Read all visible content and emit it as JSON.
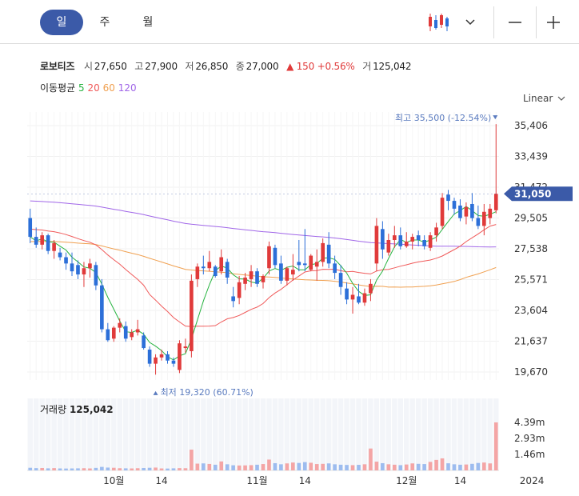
{
  "tabs": [
    "일",
    "주",
    "월"
  ],
  "active_tab": 0,
  "icons": {
    "chart_type": "candlestick-icon",
    "dropdown": "chevron-down-icon",
    "zoom_out": "minus-icon",
    "zoom_in": "plus-icon"
  },
  "stock": {
    "name": "로보티즈",
    "open_label": "시",
    "open": "27,650",
    "high_label": "고",
    "high": "27,900",
    "low_label": "저",
    "low": "26,850",
    "close_label": "종",
    "close": "27,000",
    "change": "▲ 150 +0.56%",
    "volume_label": "거",
    "volume": "125,042"
  },
  "moving_average": {
    "label": "이동평균",
    "periods": [
      "5",
      "20",
      "60",
      "120"
    ],
    "colors": {
      "5": "#27b340",
      "20": "#f05a5a",
      "60": "#f0a050",
      "120": "#a066e8"
    }
  },
  "scale_label": "Linear",
  "colors": {
    "up": "#e03a3a",
    "down": "#2c6fd8",
    "current": "#3b5aa8",
    "volume_up": "#f4a5a5",
    "volume_down": "#9dbcef"
  },
  "chart_data": {
    "type": "candlestick",
    "price_axis": {
      "ticks": [
        35406,
        33439,
        31472,
        29505,
        27538,
        25571,
        23604,
        21637,
        19670
      ],
      "labels": [
        "35,406",
        "33,439",
        "31,472",
        "29,505",
        "27,538",
        "25,571",
        "23,604",
        "21,637",
        "19,670"
      ]
    },
    "current_price": {
      "value": 31050,
      "label": "31,050"
    },
    "annotations": {
      "high": {
        "label": "최고",
        "value_text": "35,500 (-12.54%)",
        "value": 35500
      },
      "low": {
        "label": "최저",
        "value_text": "19,320 (60.71%)",
        "value": 19320
      }
    },
    "time_labels": [
      "10월",
      "14",
      "11월",
      "14",
      "12월",
      "14",
      "2024"
    ],
    "time_label_index": [
      14,
      22,
      38,
      46,
      63,
      72,
      84
    ],
    "volume_title": "거래량",
    "volume_value": "125,042",
    "volume_axis": [
      "4.39m",
      "2.93m",
      "1.46m"
    ],
    "volume_axis_values": [
      4390000,
      2930000,
      1460000
    ],
    "candles": [
      [
        29500,
        30100,
        27900,
        28300
      ],
      [
        28300,
        28900,
        27600,
        27800
      ],
      [
        27800,
        28600,
        27500,
        28400
      ],
      [
        28400,
        28500,
        27200,
        27400
      ],
      [
        27400,
        28100,
        26900,
        27900
      ],
      [
        27300,
        27600,
        26800,
        27000
      ],
      [
        27000,
        27300,
        26200,
        26600
      ],
      [
        26600,
        27300,
        25800,
        26100
      ],
      [
        26500,
        26800,
        25600,
        25900
      ],
      [
        25900,
        26700,
        25100,
        26300
      ],
      [
        26300,
        26900,
        25700,
        26600
      ],
      [
        26500,
        26700,
        24900,
        25200
      ],
      [
        25200,
        25600,
        22200,
        22400
      ],
      [
        22400,
        22800,
        21600,
        21700
      ],
      [
        21800,
        22600,
        21600,
        22500
      ],
      [
        22500,
        23100,
        22200,
        22800
      ],
      [
        22600,
        22900,
        21600,
        21800
      ],
      [
        21900,
        22400,
        21700,
        22200
      ],
      [
        22200,
        23000,
        22000,
        22400
      ],
      [
        22000,
        22200,
        21100,
        21200
      ],
      [
        21100,
        21300,
        20000,
        20200
      ],
      [
        20200,
        20800,
        19500,
        20600
      ],
      [
        20600,
        21100,
        20400,
        20800
      ],
      [
        20800,
        21000,
        20200,
        20400
      ],
      [
        20400,
        20600,
        20000,
        20200
      ],
      [
        19800,
        21700,
        19600,
        21500
      ],
      [
        21200,
        21800,
        20900,
        21300
      ],
      [
        21000,
        25900,
        20600,
        25500
      ],
      [
        25600,
        26600,
        25100,
        26400
      ],
      [
        26400,
        27100,
        25900,
        26300
      ],
      [
        26300,
        27400,
        26100,
        26700
      ],
      [
        26400,
        26500,
        25700,
        25800
      ],
      [
        26100,
        27500,
        25900,
        27000
      ],
      [
        26700,
        26900,
        25300,
        25700
      ],
      [
        24500,
        25100,
        23800,
        24200
      ],
      [
        24400,
        25800,
        24000,
        25400
      ],
      [
        25300,
        26000,
        24900,
        25700
      ],
      [
        25600,
        26500,
        25100,
        26100
      ],
      [
        26100,
        26300,
        25100,
        25300
      ],
      [
        25400,
        25900,
        25000,
        25800
      ],
      [
        26300,
        28000,
        25900,
        27700
      ],
      [
        27600,
        27800,
        26300,
        26500
      ],
      [
        26600,
        27100,
        25300,
        25500
      ],
      [
        25500,
        26400,
        25200,
        26300
      ],
      [
        25900,
        27200,
        25500,
        26200
      ],
      [
        26700,
        28100,
        26100,
        26500
      ],
      [
        26600,
        28800,
        26100,
        26500
      ],
      [
        26200,
        27200,
        26100,
        27100
      ],
      [
        26400,
        27500,
        25500,
        26700
      ],
      [
        26700,
        28200,
        26400,
        27900
      ],
      [
        27800,
        28600,
        26300,
        26600
      ],
      [
        26600,
        27100,
        25600,
        26000
      ],
      [
        26000,
        26500,
        24600,
        25100
      ],
      [
        25000,
        25400,
        24000,
        24300
      ],
      [
        24300,
        25100,
        23400,
        24600
      ],
      [
        24500,
        25300,
        24000,
        24100
      ],
      [
        24100,
        25000,
        23900,
        24700
      ],
      [
        24700,
        25600,
        24200,
        25300
      ],
      [
        26600,
        29500,
        26100,
        29000
      ],
      [
        28800,
        29300,
        26900,
        27500
      ],
      [
        27300,
        28500,
        27100,
        28100
      ],
      [
        28100,
        29000,
        27600,
        28400
      ],
      [
        28400,
        28900,
        27500,
        27700
      ],
      [
        27700,
        28600,
        27600,
        28000
      ],
      [
        28000,
        28500,
        27500,
        28300
      ],
      [
        28400,
        28700,
        27700,
        28100
      ],
      [
        28100,
        28400,
        27500,
        27700
      ],
      [
        27600,
        28600,
        27400,
        28400
      ],
      [
        28400,
        29200,
        28000,
        28900
      ],
      [
        29000,
        31100,
        28800,
        30800
      ],
      [
        31000,
        31300,
        30000,
        30600
      ],
      [
        30600,
        30800,
        29700,
        30100
      ],
      [
        30300,
        30700,
        29300,
        29500
      ],
      [
        29600,
        30500,
        29100,
        30200
      ],
      [
        30400,
        31100,
        29300,
        29500
      ],
      [
        29500,
        30300,
        28800,
        29000
      ],
      [
        29000,
        30400,
        28400,
        29900
      ],
      [
        29500,
        30400,
        29100,
        30100
      ],
      [
        30000,
        35500,
        29800,
        31050
      ]
    ],
    "volume": [
      240,
      210,
      220,
      190,
      210,
      180,
      170,
      180,
      190,
      200,
      180,
      230,
      320,
      260,
      240,
      200,
      190,
      180,
      200,
      220,
      240,
      260,
      180,
      170,
      190,
      210,
      200,
      1900,
      620,
      640,
      590,
      520,
      820,
      560,
      470,
      450,
      460,
      480,
      520,
      580,
      990,
      660,
      560,
      640,
      720,
      680,
      760,
      700,
      580,
      600,
      640,
      560,
      520,
      500,
      480,
      510,
      560,
      2000,
      800,
      660,
      560,
      520,
      480,
      540,
      640,
      600,
      580,
      780,
      960,
      1100,
      650,
      560,
      520,
      540,
      600,
      680,
      720,
      640,
      4390
    ]
  }
}
